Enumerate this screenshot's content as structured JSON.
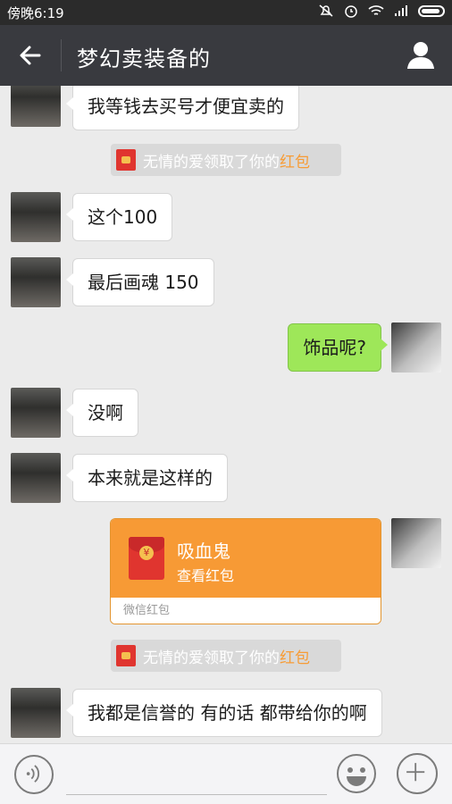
{
  "status": {
    "time": "傍晚6:19"
  },
  "header": {
    "title": "梦幻卖装备的"
  },
  "messages": [
    {
      "text": "我等钱去买号才便宜卖的"
    },
    {
      "system_prefix": "无情的爱领取了你的",
      "system_accent": "红包"
    },
    {
      "text": "这个100"
    },
    {
      "text": "最后画魂 150"
    },
    {
      "text": "饰品呢?"
    },
    {
      "text": "没啊"
    },
    {
      "text": "本来就是这样的"
    },
    {
      "rp_title": "吸血鬼",
      "rp_sub": "查看红包",
      "rp_footer": "微信红包"
    },
    {
      "system_prefix": "无情的爱领取了你的",
      "system_accent": "红包"
    },
    {
      "text": "我都是信誉的 有的话 都带给你的啊"
    }
  ],
  "colors": {
    "titlebar": "#393a3f",
    "accent": "#f79c36",
    "my_bubble": "#9ee759",
    "red_packet": "#f79a35"
  },
  "icons": [
    "back-arrow-icon",
    "profile-icon",
    "voice-icon",
    "emoji-icon",
    "plus-icon",
    "red-envelope-icon"
  ]
}
